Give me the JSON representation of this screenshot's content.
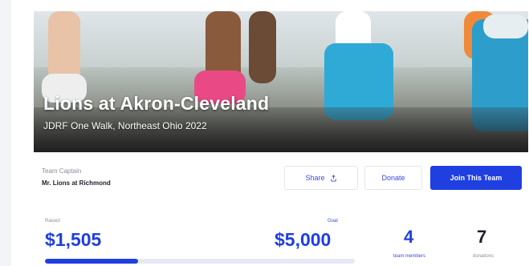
{
  "hero": {
    "title": "Lions at Akron-Cleveland",
    "subtitle": "JDRF One Walk, Northeast Ohio 2022"
  },
  "captain": {
    "label": "Team Captain",
    "name": "Mr. Lions at Richmond"
  },
  "actions": {
    "share_label": "Share",
    "share_icon": "share-icon",
    "donate_label": "Donate",
    "join_label": "Join This Team"
  },
  "stats": {
    "raised_label": "Raised",
    "raised_amount": "$1,505",
    "goal_label": "Goal",
    "goal_amount": "$5,000",
    "progress_fraction": 0.301,
    "team_members": "4",
    "team_members_label": "team members",
    "donations": "7",
    "donations_label": "donations"
  },
  "colors": {
    "accent": "#1f3fe0",
    "muted": "#8a8e99"
  }
}
